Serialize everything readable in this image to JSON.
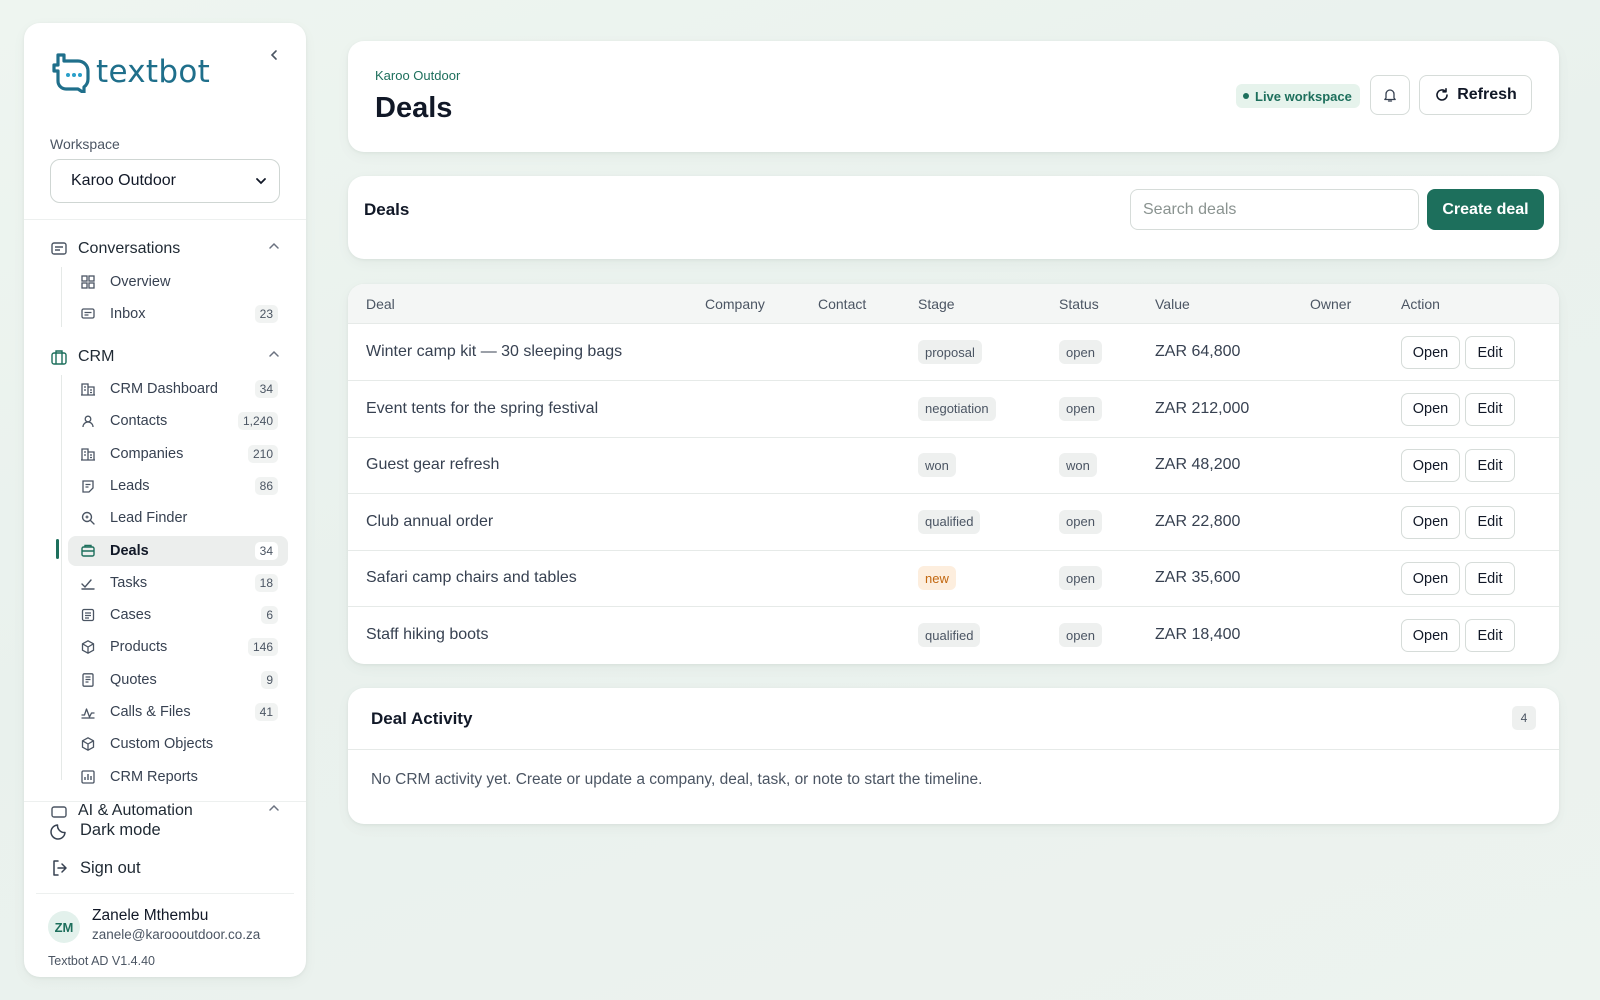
{
  "brand": {
    "name": "textbot"
  },
  "workspace": {
    "label": "Workspace",
    "selected": "Karoo Outdoor"
  },
  "sidebar": {
    "groups": [
      {
        "label": "Conversations",
        "icon": "chat-icon"
      },
      {
        "label": "CRM",
        "icon": "briefcase-icon"
      },
      {
        "label": "AI & Automation",
        "icon": "automation-icon"
      }
    ],
    "conversations_items": [
      {
        "label": "Overview",
        "count": "",
        "icon": "grid-icon"
      },
      {
        "label": "Inbox",
        "count": "23",
        "icon": "inbox-icon"
      }
    ],
    "crm_items": [
      {
        "label": "CRM Dashboard",
        "count": "34",
        "icon": "building-icon"
      },
      {
        "label": "Contacts",
        "count": "1,240",
        "icon": "contacts-icon"
      },
      {
        "label": "Companies",
        "count": "210",
        "icon": "building-icon"
      },
      {
        "label": "Leads",
        "count": "86",
        "icon": "leads-icon"
      },
      {
        "label": "Lead Finder",
        "count": "",
        "icon": "search-icon"
      },
      {
        "label": "Deals",
        "count": "34",
        "icon": "deals-icon",
        "active": true
      },
      {
        "label": "Tasks",
        "count": "18",
        "icon": "tasks-icon"
      },
      {
        "label": "Cases",
        "count": "6",
        "icon": "cases-icon"
      },
      {
        "label": "Products",
        "count": "146",
        "icon": "box-icon"
      },
      {
        "label": "Quotes",
        "count": "9",
        "icon": "quote-icon"
      },
      {
        "label": "Calls & Files",
        "count": "41",
        "icon": "activity-icon"
      },
      {
        "label": "Custom Objects",
        "count": "",
        "icon": "cube-icon"
      },
      {
        "label": "CRM Reports",
        "count": "",
        "icon": "report-icon"
      }
    ],
    "bottom": {
      "dark_mode": "Dark mode",
      "sign_out": "Sign out"
    },
    "user": {
      "initials": "ZM",
      "name": "Zanele Mthembu",
      "email": "zanele@karoooutdoor.co.za"
    },
    "version": "Textbot AD V1.4.40"
  },
  "header": {
    "breadcrumb": "Karoo Outdoor",
    "title": "Deals",
    "live_badge": "Live workspace",
    "refresh_label": "Refresh"
  },
  "toolbar": {
    "title": "Deals",
    "search_placeholder": "Search deals",
    "create_label": "Create deal"
  },
  "table": {
    "columns": [
      "Deal",
      "Company",
      "Contact",
      "Stage",
      "Status",
      "Value",
      "Owner",
      "Action"
    ],
    "rows": [
      {
        "deal": "Winter camp kit — 30 sleeping bags",
        "company": "",
        "contact": "",
        "stage": "proposal",
        "status": "open",
        "value": "ZAR 64,800",
        "owner": ""
      },
      {
        "deal": "Event tents for the spring festival",
        "company": "",
        "contact": "",
        "stage": "negotiation",
        "status": "open",
        "value": "ZAR 212,000",
        "owner": ""
      },
      {
        "deal": "Guest gear refresh",
        "company": "",
        "contact": "",
        "stage": "won",
        "status": "won",
        "value": "ZAR 48,200",
        "owner": ""
      },
      {
        "deal": "Club annual order",
        "company": "",
        "contact": "",
        "stage": "qualified",
        "status": "open",
        "value": "ZAR 22,800",
        "owner": ""
      },
      {
        "deal": "Safari camp chairs and tables",
        "company": "",
        "contact": "",
        "stage": "new",
        "status": "open",
        "value": "ZAR 35,600",
        "owner": ""
      },
      {
        "deal": "Staff hiking boots",
        "company": "",
        "contact": "",
        "stage": "qualified",
        "status": "open",
        "value": "ZAR 18,400",
        "owner": ""
      }
    ],
    "open_label": "Open",
    "edit_label": "Edit"
  },
  "activity": {
    "title": "Deal Activity",
    "count": "4",
    "empty_text": "No CRM activity yet. Create or update a company, deal, task, or note to start the timeline."
  },
  "colors": {
    "accent": "#1d6f5c",
    "brand": "#1f6f8b",
    "new_stage_bg": "#fdeede",
    "new_stage_text": "#c2670f"
  }
}
